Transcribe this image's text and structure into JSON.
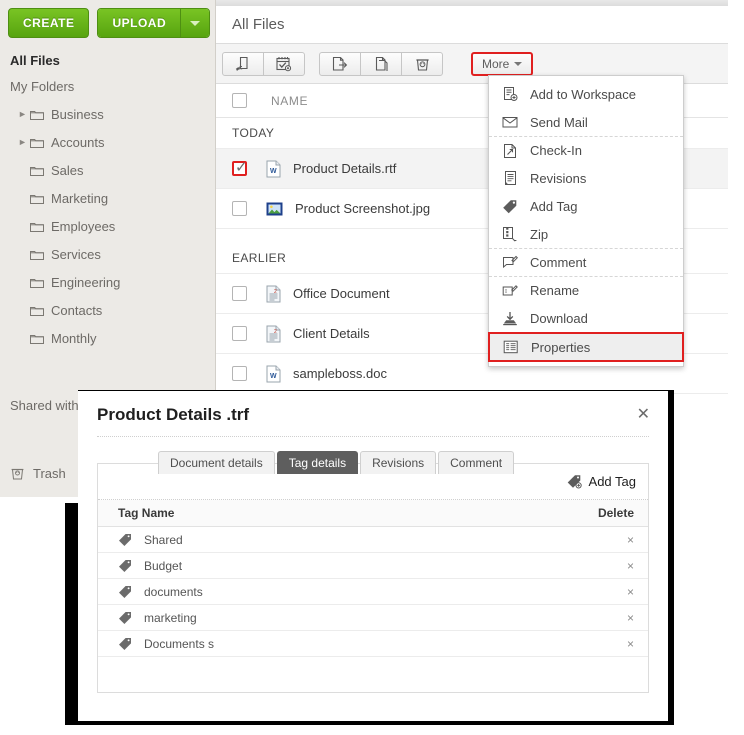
{
  "sidebar": {
    "create_label": "CREATE",
    "upload_label": "UPLOAD",
    "upload_caret_icon": "chevron-down-icon",
    "all_files_label": "All Files",
    "my_folders_label": "My Folders",
    "folders": [
      {
        "label": "Business",
        "expandable": true,
        "icon": "folder-icon"
      },
      {
        "label": "Accounts",
        "expandable": true,
        "icon": "folder-icon"
      },
      {
        "label": "Sales",
        "expandable": false,
        "icon": "folder-icon"
      },
      {
        "label": "Marketing",
        "expandable": false,
        "icon": "folder-icon"
      },
      {
        "label": "Employees",
        "expandable": false,
        "icon": "folder-icon"
      },
      {
        "label": "Services",
        "expandable": false,
        "icon": "folder-icon"
      },
      {
        "label": "Engineering",
        "expandable": false,
        "icon": "folder-icon"
      },
      {
        "label": "Contacts",
        "expandable": false,
        "icon": "folder-icon"
      },
      {
        "label": "Monthly",
        "expandable": false,
        "icon": "folder-icon"
      }
    ],
    "shared_label": "Shared with",
    "trash_label": "Trash",
    "trash_icon": "trash-icon"
  },
  "main": {
    "title": "All Files",
    "toolbar": {
      "buttons": [
        {
          "name": "share-button",
          "icon": "share-icon"
        },
        {
          "name": "task-button",
          "icon": "calendar-check-icon"
        },
        {
          "name": "move-button",
          "icon": "move-out-icon"
        },
        {
          "name": "copy-button",
          "icon": "copy-icon"
        },
        {
          "name": "delete-button",
          "icon": "trash-icon"
        }
      ],
      "more_label": "More",
      "more_caret_icon": "chevron-down-icon"
    },
    "column_name": "NAME",
    "groups": [
      {
        "label": "TODAY",
        "files": [
          {
            "name": "Product Details.rtf",
            "icon": "word-file-icon",
            "checked": true
          },
          {
            "name": "Product Screenshot.jpg",
            "icon": "image-file-icon",
            "checked": false
          }
        ]
      },
      {
        "label": "EARLIER",
        "files": [
          {
            "name": "Office Document",
            "icon": "doc-file-icon",
            "checked": false
          },
          {
            "name": "Client Details",
            "icon": "doc-file-icon",
            "checked": false
          },
          {
            "name": "sampleboss.doc",
            "icon": "word-file-icon",
            "checked": false
          }
        ]
      }
    ]
  },
  "more_menu": {
    "items": [
      {
        "label": "Add to Workspace",
        "icon": "add-to-workspace-icon",
        "separator_above": false,
        "highlighted": false
      },
      {
        "label": "Send Mail",
        "icon": "mail-icon",
        "separator_above": false,
        "highlighted": false
      },
      {
        "label": "Check-In",
        "icon": "check-in-icon",
        "separator_above": true,
        "highlighted": false
      },
      {
        "label": "Revisions",
        "icon": "revisions-icon",
        "separator_above": false,
        "highlighted": false
      },
      {
        "label": "Add Tag",
        "icon": "tag-icon",
        "separator_above": false,
        "highlighted": false
      },
      {
        "label": "Zip",
        "icon": "zip-icon",
        "separator_above": false,
        "highlighted": false
      },
      {
        "label": "Comment",
        "icon": "comment-icon",
        "separator_above": true,
        "highlighted": false
      },
      {
        "label": "Rename",
        "icon": "rename-icon",
        "separator_above": true,
        "highlighted": false
      },
      {
        "label": "Download",
        "icon": "download-icon",
        "separator_above": false,
        "highlighted": false
      },
      {
        "label": "Properties",
        "icon": "properties-icon",
        "separator_above": false,
        "highlighted": true
      }
    ]
  },
  "modal": {
    "title": "Product Details .trf",
    "close_icon": "close-icon",
    "tabs": [
      {
        "label": "Document details",
        "active": false
      },
      {
        "label": "Tag details",
        "active": true
      },
      {
        "label": "Revisions",
        "active": false
      },
      {
        "label": "Comment",
        "active": false
      }
    ],
    "add_tag_label": "Add Tag",
    "add_tag_icon": "tag-plus-icon",
    "table": {
      "columns": [
        "Tag Name",
        "Delete"
      ],
      "rows": [
        {
          "tag": "Shared",
          "delete_label": "×",
          "icon": "tag-icon"
        },
        {
          "tag": "Budget",
          "delete_label": "×",
          "icon": "tag-icon"
        },
        {
          "tag": "documents",
          "delete_label": "×",
          "icon": "tag-icon"
        },
        {
          "tag": "marketing",
          "delete_label": "×",
          "icon": "tag-icon"
        },
        {
          "tag": "Documents s",
          "delete_label": "×",
          "icon": "tag-icon"
        }
      ]
    }
  },
  "colors": {
    "brand_green": "#63b215",
    "highlight_red": "#e02020",
    "tab_active_bg": "#5e5e5e",
    "sidebar_bg": "#eceae6"
  }
}
